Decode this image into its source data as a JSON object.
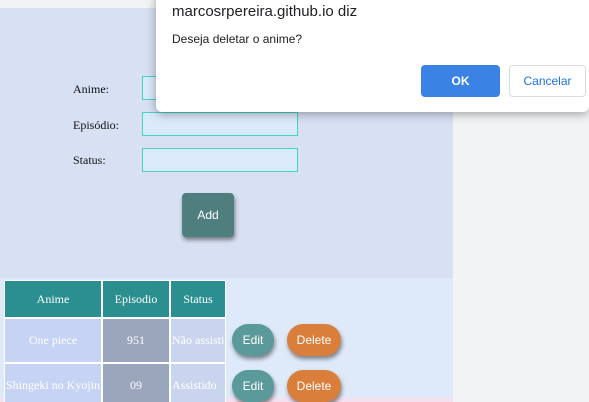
{
  "form": {
    "anime_label": "Anime:",
    "episode_label": "Episódio:",
    "status_label": "Status:",
    "anime_value": "",
    "episode_value": "",
    "status_value": "",
    "add_label": "Add"
  },
  "table": {
    "headers": [
      "Anime",
      "Episodio",
      "Status"
    ],
    "rows": [
      {
        "anime": "One piece",
        "episode": "951",
        "status": "Não assisti",
        "edit": "Edit",
        "delete": "Delete"
      },
      {
        "anime": "Shingeki no Kyojin",
        "episode": "09",
        "status": "Assistido",
        "edit": "Edit",
        "delete": "Delete"
      }
    ]
  },
  "dialog": {
    "title": "marcosrpereira.github.io diz",
    "message": "Deseja deletar o anime?",
    "ok_label": "OK",
    "cancel_label": "Cancelar"
  },
  "colors": {
    "header_teal": "#2b8f8f",
    "edit_teal": "#5b9a9a",
    "delete_orange": "#d97f3b",
    "ok_blue": "#3b82e5"
  }
}
